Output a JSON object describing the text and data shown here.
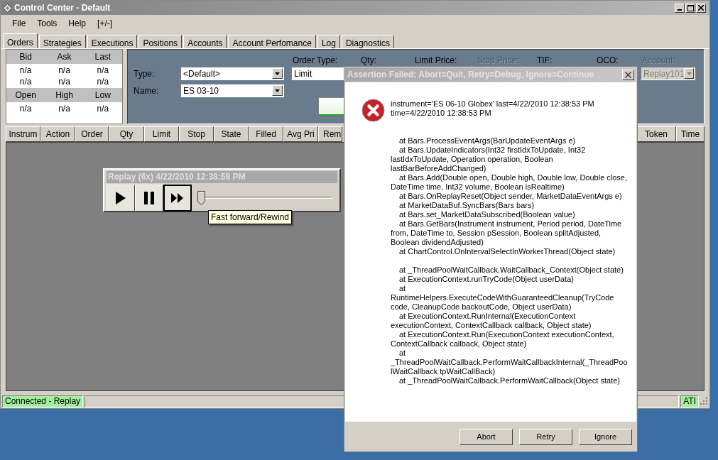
{
  "window": {
    "title": "Control Center - Default"
  },
  "menu": [
    "File",
    "Tools",
    "Help",
    "[+/-]"
  ],
  "tabs": [
    {
      "label": "Orders",
      "selected": true
    },
    {
      "label": "Strategies",
      "selected": false
    },
    {
      "label": "Executions",
      "selected": false
    },
    {
      "label": "Positions",
      "selected": false
    },
    {
      "label": "Accounts",
      "selected": false
    },
    {
      "label": "Account Perfomance",
      "selected": false
    },
    {
      "label": "Log",
      "selected": false
    },
    {
      "label": "Diagnostics",
      "selected": false
    }
  ],
  "quote": [
    {
      "headers": [
        "Bid",
        "Ask",
        "Last"
      ],
      "rows": [
        [
          "n/a",
          "n/a",
          "n/a"
        ],
        [
          "n/a",
          "n/a",
          "n/a"
        ]
      ]
    },
    {
      "headers": [
        "Open",
        "High",
        "Low"
      ],
      "rows": [
        [
          "n/a",
          "n/a",
          "n/a"
        ]
      ]
    }
  ],
  "order_entry": {
    "type_label": "Type:",
    "type_value": "<Default>",
    "name_label": "Name:",
    "name_value": "ES 03-10",
    "column_labels": [
      {
        "text": "Order Type:",
        "disabled": false
      },
      {
        "text": "Qty:",
        "disabled": false
      },
      {
        "text": "Limit Price:",
        "disabled": false
      },
      {
        "text": "Stop Price:",
        "disabled": true
      },
      {
        "text": "TIF:",
        "disabled": false
      },
      {
        "text": "OCO:",
        "disabled": false
      },
      {
        "text": "Account:",
        "disabled": true
      }
    ],
    "order_type_value": "Limit",
    "account_value": "Replay101",
    "account_disabled": true
  },
  "orders_table": {
    "columns": [
      "Instrum",
      "Action",
      "Order",
      "Qty",
      "Limit",
      "Stop",
      "State",
      "Filled",
      "Avg Pri",
      "Rem"
    ],
    "right_columns": [
      "Token",
      "Time"
    ]
  },
  "replay": {
    "title": "Replay (6x) 4/22/2010 12:38:58 PM",
    "buttons": [
      {
        "kind": "play",
        "selected": false
      },
      {
        "kind": "pause",
        "selected": false
      },
      {
        "kind": "fast-forward",
        "selected": true
      }
    ],
    "slider": {
      "level": 0
    },
    "tooltip": "Fast forward/Rewind"
  },
  "status_bar": {
    "connection": "Connected - Replay",
    "right": "ATI"
  },
  "dialog": {
    "title": "Assertion Failed: Abort=Quit, Retry=Debug, Ignore=Continue",
    "message": "instrument='ES 06-10 Globex' last=4/22/2010 12:38:53 PM time=4/22/2010 12:38:53 PM",
    "stack": [
      {
        "text": "at Bars.ProcessEventArgs(BarUpdateEventArgs e)",
        "gap_before": false
      },
      {
        "text": "at Bars.UpdateIndicators(Int32 firstIdxToUpdate, Int32 lastIdxToUpdate, Operation operation, Boolean lastBarBeforeAddChanged)",
        "gap_before": false
      },
      {
        "text": "at Bars.Add(Double open, Double high, Double low, Double close, DateTime time, Int32 volume, Boolean isRealtime)",
        "gap_before": false
      },
      {
        "text": "at Bars.OnReplayReset(Object sender, MarketDataEventArgs e)",
        "gap_before": false
      },
      {
        "text": "at MarketDataBuf.SyncBars(Bars bars)",
        "gap_before": false
      },
      {
        "text": "at Bars.set_MarketDataSubscribed(Boolean value)",
        "gap_before": false
      },
      {
        "text": "at Bars.GetBars(Instrument instrument, Period period, DateTime from, DateTime to, Session pSession, Boolean splitAdjusted, Boolean dividendAdjusted)",
        "gap_before": false
      },
      {
        "text": "at ChartControl.OnIntervalSelectInWorkerThread(Object state)",
        "gap_before": false
      },
      {
        "text": "at _ThreadPoolWaitCallback.WaitCallback_Context(Object state)",
        "gap_before": true
      },
      {
        "text": "at ExecutionContext.runTryCode(Object userData)",
        "gap_before": false
      },
      {
        "text": "at RuntimeHelpers.ExecuteCodeWithGuaranteedCleanup(TryCode code, CleanupCode backoutCode, Object userData)",
        "gap_before": false
      },
      {
        "text": "at ExecutionContext.RunInternal(ExecutionContext executionContext, ContextCallback callback, Object state)",
        "gap_before": false
      },
      {
        "text": "at ExecutionContext.Run(ExecutionContext executionContext, ContextCallback callback, Object state)",
        "gap_before": false
      },
      {
        "text": "at _ThreadPoolWaitCallback.PerformWaitCallbackInternal(_ThreadPoolWaitCallback tpWaitCallBack)",
        "gap_before": false
      },
      {
        "text": "at _ThreadPoolWaitCallback.PerformWaitCallback(Object state)",
        "gap_before": false
      }
    ],
    "buttons": [
      "Abort",
      "Retry",
      "Ignore"
    ]
  }
}
